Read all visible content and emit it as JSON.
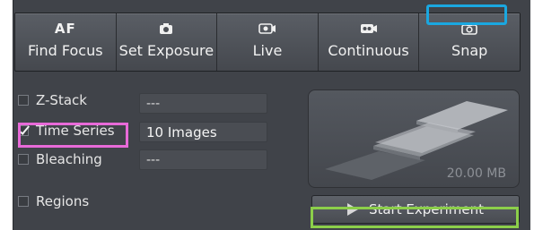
{
  "toolbar": {
    "buttons": [
      {
        "label": "Find Focus",
        "icon": "af-icon",
        "glyph": "AF"
      },
      {
        "label": "Set Exposure",
        "icon": "camera-icon"
      },
      {
        "label": "Live",
        "icon": "live-camera-icon"
      },
      {
        "label": "Continuous",
        "icon": "continuous-camera-icon"
      },
      {
        "label": "Snap",
        "icon": "snap-camera-icon"
      }
    ]
  },
  "options": [
    {
      "label": "Z-Stack",
      "checked": false,
      "value": "---"
    },
    {
      "label": "Time Series",
      "checked": true,
      "value": "10 Images"
    },
    {
      "label": "Bleaching",
      "checked": false,
      "value": "---"
    },
    {
      "label": "Regions",
      "checked": false
    }
  ],
  "preview": {
    "size": "20.00 MB"
  },
  "start_button": {
    "label": "Start Experiment"
  },
  "colors": {
    "panel": "#404349",
    "highlight_blue": "#1aa7e0",
    "highlight_pink": "#e86ad8",
    "highlight_green": "#8ccf4a"
  }
}
